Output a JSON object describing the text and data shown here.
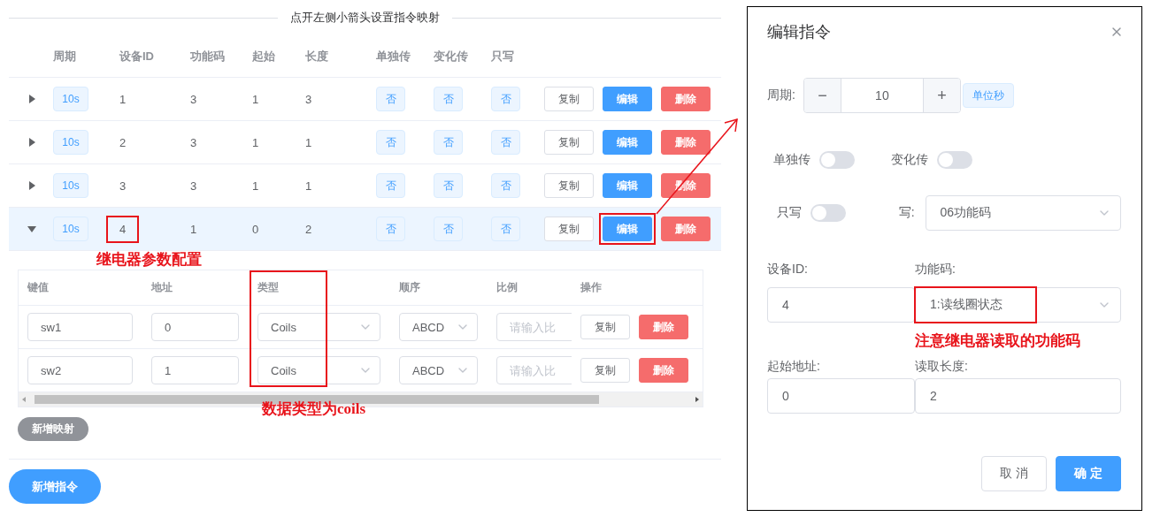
{
  "banner": "点开左侧小箭头设置指令映射",
  "commands": {
    "columns": [
      "周期",
      "设备ID",
      "功能码",
      "起始",
      "长度",
      "单独传",
      "变化传",
      "只写"
    ],
    "rows": [
      {
        "expanded": false,
        "cycle": "10s",
        "device_id": "1",
        "function_code": "3",
        "start": "1",
        "length": "3",
        "single": "否",
        "change": "否",
        "write_only": "否",
        "id_highlighted": false,
        "edit_highlighted": false,
        "actions": [
          "复制",
          "编辑",
          "删除"
        ]
      },
      {
        "expanded": false,
        "cycle": "10s",
        "device_id": "2",
        "function_code": "3",
        "start": "1",
        "length": "1",
        "single": "否",
        "change": "否",
        "write_only": "否",
        "id_highlighted": false,
        "edit_highlighted": false,
        "actions": [
          "复制",
          "编辑",
          "删除"
        ]
      },
      {
        "expanded": false,
        "cycle": "10s",
        "device_id": "3",
        "function_code": "3",
        "start": "1",
        "length": "1",
        "single": "否",
        "change": "否",
        "write_only": "否",
        "id_highlighted": false,
        "edit_highlighted": false,
        "actions": [
          "复制",
          "编辑",
          "删除"
        ]
      },
      {
        "expanded": true,
        "cycle": "10s",
        "device_id": "4",
        "function_code": "1",
        "start": "0",
        "length": "2",
        "single": "否",
        "change": "否",
        "write_only": "否",
        "id_highlighted": true,
        "edit_highlighted": true,
        "actions": [
          "复制",
          "编辑",
          "删除"
        ]
      }
    ]
  },
  "mapping": {
    "columns": [
      "键值",
      "地址",
      "类型",
      "顺序",
      "比例",
      "操作"
    ],
    "rows": [
      {
        "key": "sw1",
        "address": "0",
        "type": "Coils",
        "order": "ABCD",
        "ratio_placeholder": "请输入比",
        "actions": [
          "复制",
          "删除"
        ]
      },
      {
        "key": "sw2",
        "address": "1",
        "type": "Coils",
        "order": "ABCD",
        "ratio_placeholder": "请输入比",
        "actions": [
          "复制",
          "删除"
        ]
      }
    ],
    "type_column_highlighted": true,
    "add_button": "新增映射"
  },
  "add_command": "新增指令",
  "annotations": [
    {
      "text": "继电器参数配置"
    },
    {
      "text": "数据类型为coils"
    },
    {
      "text": "注意继电器读取的功能码"
    }
  ],
  "dialog": {
    "title": "编辑指令",
    "cycle_label": "周期:",
    "cycle_value": "10",
    "decrement": "−",
    "increment": "+",
    "unit": "单位秒",
    "switches": [
      {
        "label": "单独传",
        "on": false
      },
      {
        "label": "变化传",
        "on": false
      },
      {
        "label": "只写",
        "on": false
      }
    ],
    "write_label": "写:",
    "write_value": "06功能码",
    "fields": [
      {
        "label": "设备ID:",
        "value": "4",
        "kind": "input",
        "highlighted": false
      },
      {
        "label": "功能码:",
        "value": "1:读线圈状态",
        "kind": "select",
        "highlighted": true
      },
      {
        "label": "起始地址:",
        "value": "0",
        "kind": "input",
        "highlighted": false
      },
      {
        "label": "读取长度:",
        "value": "2",
        "kind": "input",
        "highlighted": false
      }
    ],
    "buttons": [
      {
        "label": "取 消",
        "kind": "default"
      },
      {
        "label": "确 定",
        "kind": "primary"
      }
    ]
  }
}
